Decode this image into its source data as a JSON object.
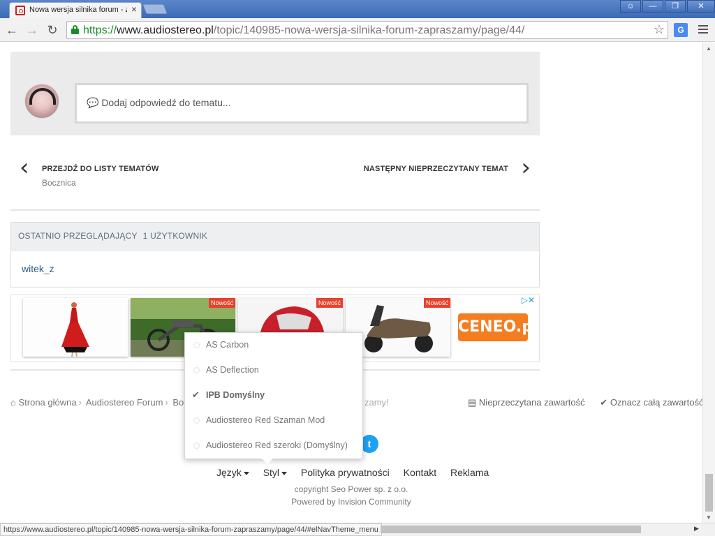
{
  "browser": {
    "tab_title": "Nowa wersja silnika forum - z",
    "tab_close": "×",
    "window_buttons": {
      "user": "☺",
      "minimize": "—",
      "restore": "❐",
      "close": "✕"
    },
    "back": "←",
    "forward": "→",
    "reload": "↻",
    "url_scheme": "https://",
    "url_host": "www.audiostereo.pl",
    "url_path": "/topic/140985-nowa-wersja-silnika-forum-zapraszamy/page/44/",
    "star": "☆",
    "translate": "G",
    "status_url": "https://www.audiostereo.pl/topic/140985-nowa-wersja-silnika-forum-zapraszamy/page/44/#elNavTheme_menu"
  },
  "reply": {
    "placeholder": "💬 Dodaj odpowiedź do tematu..."
  },
  "pager": {
    "prev_title": "PRZEJDŹ DO LISTY TEMATÓW",
    "prev_sub": "Bocznica",
    "next_title": "NASTĘPNY NIEPRZECZYTANY TEMAT",
    "prev_chev": "‹",
    "next_chev": "›"
  },
  "viewers": {
    "heading": "OSTATNIO PRZEGLĄDAJĄCY",
    "count": "1 UŻYTKOWNIK",
    "user": "witek_z"
  },
  "ads": {
    "badge": "Nowość",
    "ceneo": "CENEO.pl",
    "ad_choices": "▷✕"
  },
  "breadcrumb": {
    "home": "Strona główna",
    "forum": "Audiostereo Forum",
    "partial": "Bo",
    "tail": "zamy!",
    "unread": "Nieprzeczytana zawartość",
    "mark_all": "Oznacz całą zawartość ja"
  },
  "footer": {
    "language": "Język",
    "style": "Styl",
    "privacy": "Polityka prywatności",
    "contact": "Kontakt",
    "ads": "Reklama",
    "copyright": "copyright Seo Power sp. z o.o.",
    "powered": "Powered by Invision Community"
  },
  "theme_menu": {
    "items": [
      {
        "label": "AS Carbon",
        "selected": false
      },
      {
        "label": "AS Deflection",
        "selected": false
      },
      {
        "label": "IPB Domyślny",
        "selected": true
      },
      {
        "label": "Audiostereo Red Szaman Mod",
        "selected": false
      },
      {
        "label": "Audiostereo Red szeroki (Domyślny)",
        "selected": false
      }
    ]
  },
  "colors": {
    "chrome_blue": "#3c6bb5",
    "link": "#2e5e87",
    "badge": "#e8412c",
    "ceneo": "#f47d20",
    "twitter": "#1da1f2",
    "secure_green": "#1e8a2e"
  }
}
